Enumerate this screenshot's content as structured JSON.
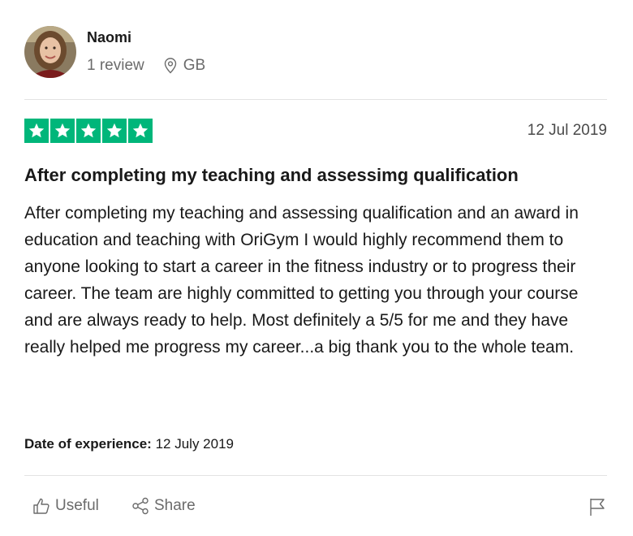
{
  "reviewer": {
    "name": "Naomi",
    "review_count": "1 review",
    "location": "GB",
    "location_icon": "location-pin-icon"
  },
  "review": {
    "rating": 5,
    "max_rating": 5,
    "star_color": "#00b67a",
    "date": "12 Jul 2019",
    "title": "After completing my teaching and assessimg qualification",
    "body": "After completing my teaching and assessing qualification and an award in education and teaching with OriGym I would highly recommend them to anyone looking to start a career in the fitness industry or to progress their career. The team are highly committed to getting you through your course and are always ready to help. Most definitely a 5/5 for me and they have really helped me progress my career...a big thank you to the whole team.",
    "experience_label": "Date of experience:",
    "experience_date": "12 July 2019"
  },
  "actions": {
    "useful_label": "Useful",
    "useful_icon": "thumbs-up-icon",
    "share_label": "Share",
    "share_icon": "share-icon",
    "report_icon": "flag-icon"
  }
}
